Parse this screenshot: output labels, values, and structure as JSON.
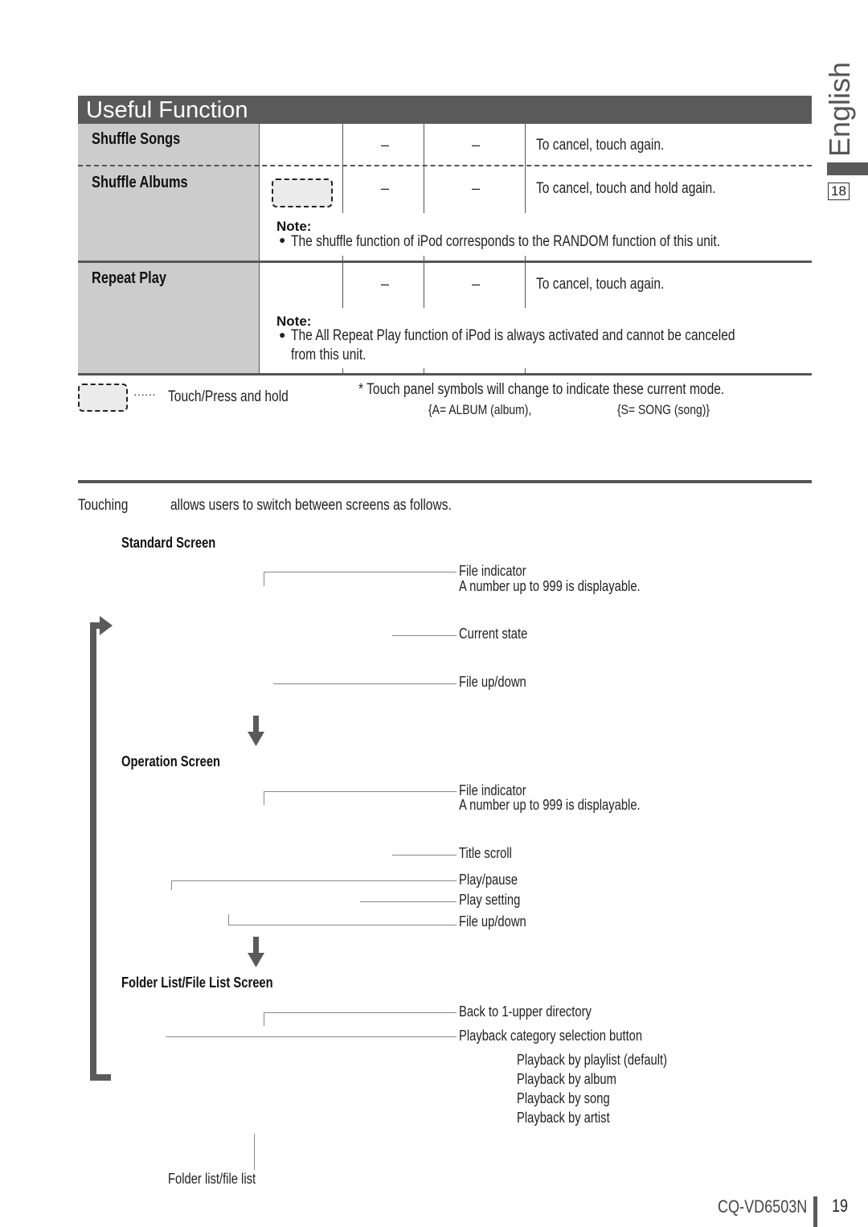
{
  "side_tab": {
    "language": "English",
    "page_ref": "18"
  },
  "table": {
    "title": "Useful Function",
    "rows": [
      {
        "label": "Shuffle Songs",
        "col2": "–",
        "col3": "–",
        "remark": "To cancel, touch again."
      },
      {
        "label": "Shuffle Albums",
        "col2": "–",
        "col3": "–",
        "remark": "To cancel, touch and hold again."
      },
      {
        "label": "Repeat Play",
        "col2": "–",
        "col3": "–",
        "remark": "To cancel, touch again."
      }
    ],
    "notes": [
      {
        "heading": "Note:",
        "bullet": "●",
        "text": "The shuffle function of iPod corresponds to the RANDOM function of this unit."
      },
      {
        "heading": "Note:",
        "bullet": "●",
        "text_line1": "The All Repeat Play function of iPod is always activated and cannot be canceled",
        "text_line2": "from this unit."
      }
    ]
  },
  "legend": {
    "dots": "······",
    "touch_hold": "Touch/Press and hold",
    "footnote": "* Touch panel symbols will change to indicate these current mode.",
    "mode_a": "{A= ALBUM (album),",
    "mode_s": "{S= SONG (song)}"
  },
  "screens": {
    "intro_left": "Touching",
    "intro_right": "allows users to switch between screens as follows.",
    "standard": {
      "title": "Standard Screen",
      "callouts": {
        "file_indicator": "File indicator",
        "file_indicator_note": "A number up to 999 is displayable.",
        "current_state": "Current state",
        "file_updown": "File up/down"
      }
    },
    "operation": {
      "title": "Operation Screen",
      "callouts": {
        "file_indicator": "File indicator",
        "file_indicator_note": "A number up to 999 is displayable.",
        "title_scroll": "Title scroll",
        "play_pause": "Play/pause",
        "play_setting": "Play setting",
        "file_updown": "File up/down"
      }
    },
    "folder_list": {
      "title": "Folder List/File List Screen",
      "callouts": {
        "back_upper": "Back to 1-upper directory",
        "category_button": "Playback category selection button",
        "category_options": [
          "Playback by playlist (default)",
          "Playback by album",
          "Playback by song",
          "Playback by artist"
        ],
        "folder_file_list": "Folder list/file list"
      }
    }
  },
  "footer": {
    "model": "CQ-VD6503N",
    "page": "19"
  }
}
